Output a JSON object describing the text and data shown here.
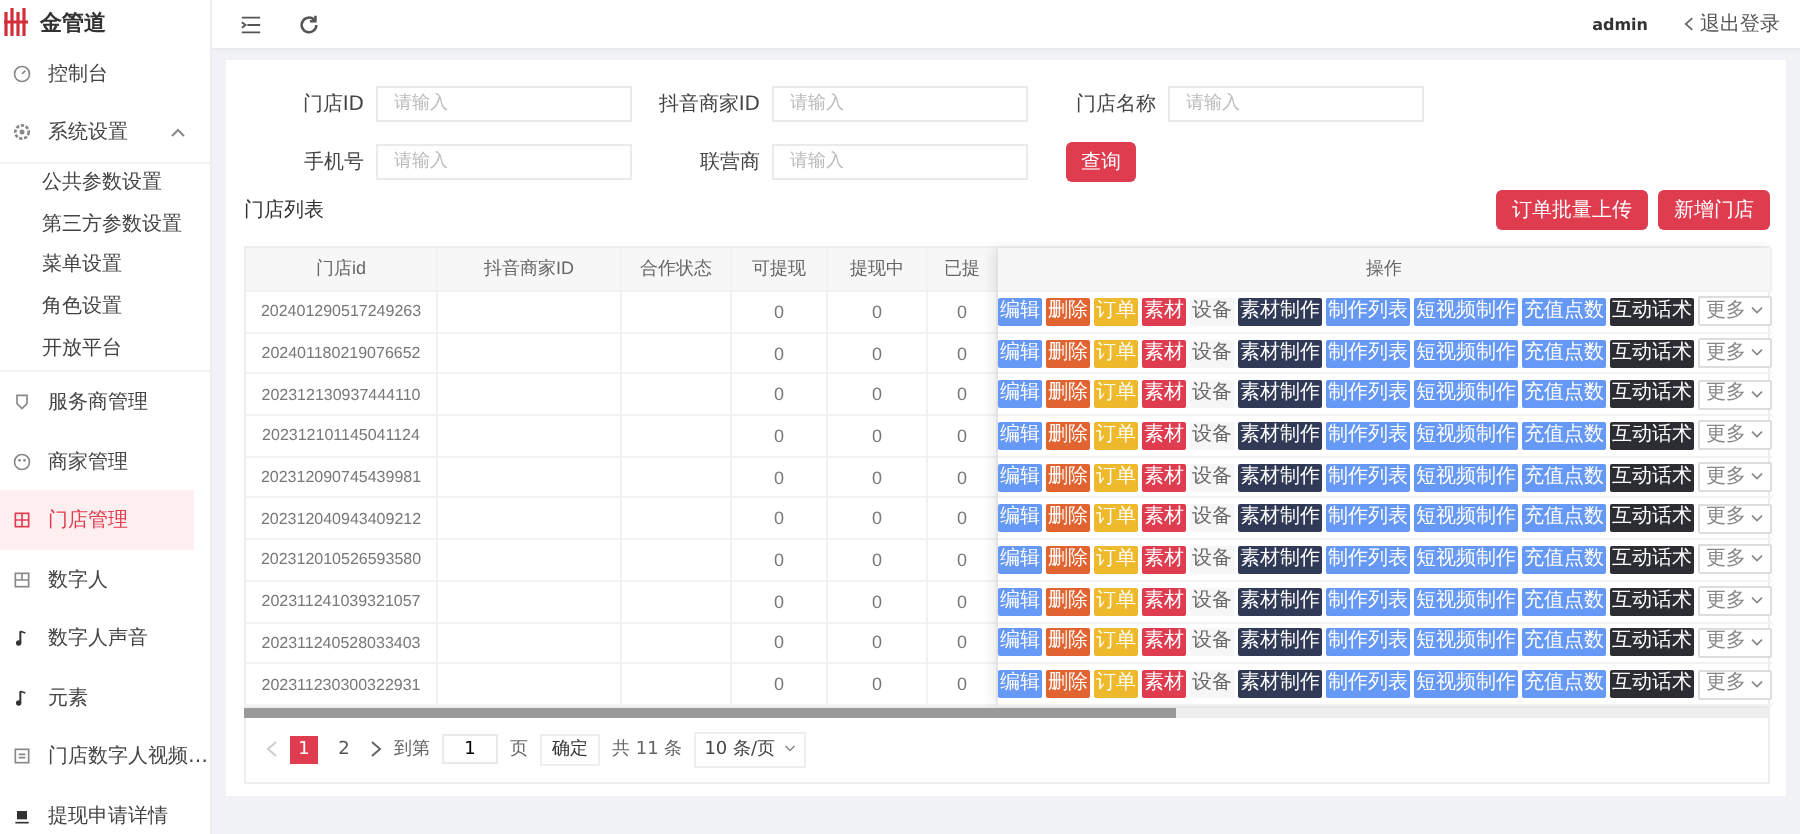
{
  "brand": {
    "name": "金管道"
  },
  "sidebar": {
    "items": [
      {
        "label": "控制台",
        "selected": false
      },
      {
        "label": "系统设置",
        "selected": false,
        "expanded": true,
        "children": [
          {
            "label": "公共参数设置",
            "selected": false
          },
          {
            "label": "第三方参数设置",
            "selected": false
          },
          {
            "label": "菜单设置",
            "selected": false
          },
          {
            "label": "角色设置",
            "selected": false
          },
          {
            "label": "开放平台",
            "selected": false
          }
        ]
      },
      {
        "label": "服务商管理",
        "selected": false
      },
      {
        "label": "商家管理",
        "selected": false
      },
      {
        "label": "门店管理",
        "selected": true
      },
      {
        "label": "数字人",
        "selected": false
      },
      {
        "label": "数字人声音",
        "selected": false
      },
      {
        "label": "元素",
        "selected": false
      },
      {
        "label": "门店数字人视频…",
        "selected": false
      },
      {
        "label": "提现申请详情",
        "selected": false
      }
    ]
  },
  "header": {
    "user": "admin",
    "logout": "退出登录"
  },
  "filters": [
    {
      "label": "门店ID",
      "placeholder": "请输入"
    },
    {
      "label": "抖音商家ID",
      "placeholder": "请输入"
    },
    {
      "label": "门店名称",
      "placeholder": "请输入"
    },
    {
      "label": "手机号",
      "placeholder": "请输入"
    },
    {
      "label": "联营商",
      "placeholder": "请输入"
    }
  ],
  "search_button": "查询",
  "list_title": "门店列表",
  "toolbar_buttons": [
    "订单批量上传",
    "新增门店"
  ],
  "table": {
    "columns": [
      "门店id",
      "抖音商家ID",
      "合作状态",
      "可提现",
      "提现中",
      "已提"
    ],
    "actions_column": "操作",
    "rows": [
      {
        "store_id": "202401290517249263",
        "withdrawable": "0",
        "withdrawing": "0",
        "withdrawn": "0"
      },
      {
        "store_id": "202401180219076652",
        "withdrawable": "0",
        "withdrawing": "0",
        "withdrawn": "0"
      },
      {
        "store_id": "202312130937444110",
        "withdrawable": "0",
        "withdrawing": "0",
        "withdrawn": "0"
      },
      {
        "store_id": "202312101145041124",
        "withdrawable": "0",
        "withdrawing": "0",
        "withdrawn": "0"
      },
      {
        "store_id": "202312090745439981",
        "withdrawable": "0",
        "withdrawing": "0",
        "withdrawn": "0"
      },
      {
        "store_id": "202312040943409212",
        "withdrawable": "0",
        "withdrawing": "0",
        "withdrawn": "0"
      },
      {
        "store_id": "202312010526593580",
        "withdrawable": "0",
        "withdrawing": "0",
        "withdrawn": "0"
      },
      {
        "store_id": "202311241039321057",
        "withdrawable": "0",
        "withdrawing": "0",
        "withdrawn": "0"
      },
      {
        "store_id": "202311240528033403",
        "withdrawable": "0",
        "withdrawing": "0",
        "withdrawn": "0"
      },
      {
        "store_id": "202311230300322931",
        "withdrawable": "0",
        "withdrawing": "0",
        "withdrawn": "0"
      }
    ],
    "row_actions": [
      [
        {
          "label": "编辑",
          "kind": "primary"
        },
        {
          "label": "删除",
          "kind": "warning"
        },
        {
          "label": "订单",
          "kind": "caution"
        },
        {
          "label": "素材",
          "kind": "danger"
        },
        {
          "label": "设备",
          "kind": "plain"
        },
        {
          "label": "素材制作",
          "kind": "navy"
        },
        {
          "label": "制作列表",
          "kind": "primary"
        },
        {
          "label": "短视频制作",
          "kind": "primary"
        },
        {
          "label": "充值点数",
          "kind": "primary"
        },
        {
          "label": "互动话术",
          "kind": "dark"
        },
        {
          "label": "更多",
          "kind": "dropdown"
        }
      ],
      [
        {
          "label": "编辑",
          "kind": "primary"
        },
        {
          "label": "删除",
          "kind": "warning"
        },
        {
          "label": "订单",
          "kind": "caution"
        },
        {
          "label": "素材",
          "kind": "danger"
        },
        {
          "label": "设备",
          "kind": "plain"
        },
        {
          "label": "素材制作",
          "kind": "navy"
        },
        {
          "label": "制作列表",
          "kind": "primary"
        },
        {
          "label": "短视频制作",
          "kind": "primary"
        },
        {
          "label": "充值点数",
          "kind": "primary"
        },
        {
          "label": "互动话术",
          "kind": "dark"
        },
        {
          "label": "更多",
          "kind": "dropdown"
        }
      ],
      [
        {
          "label": "编辑",
          "kind": "primary"
        },
        {
          "label": "删除",
          "kind": "warning"
        },
        {
          "label": "订单",
          "kind": "caution"
        },
        {
          "label": "素材",
          "kind": "danger"
        },
        {
          "label": "设备",
          "kind": "plain"
        },
        {
          "label": "素材制作",
          "kind": "navy"
        },
        {
          "label": "制作列表",
          "kind": "primary"
        },
        {
          "label": "短视频制作",
          "kind": "primary"
        },
        {
          "label": "充值点数",
          "kind": "primary"
        },
        {
          "label": "互动话术",
          "kind": "dark"
        },
        {
          "label": "更多",
          "kind": "dropdown"
        }
      ],
      [
        {
          "label": "编辑",
          "kind": "primary"
        },
        {
          "label": "删除",
          "kind": "warning"
        },
        {
          "label": "订单",
          "kind": "caution"
        },
        {
          "label": "素材",
          "kind": "danger"
        },
        {
          "label": "设备",
          "kind": "plain"
        },
        {
          "label": "素材制作",
          "kind": "navy"
        },
        {
          "label": "制作列表",
          "kind": "primary"
        },
        {
          "label": "短视频制作",
          "kind": "primary"
        },
        {
          "label": "充值点数",
          "kind": "primary"
        },
        {
          "label": "互动话术",
          "kind": "dark"
        },
        {
          "label": "更多",
          "kind": "dropdown"
        }
      ],
      [
        {
          "label": "编辑",
          "kind": "primary"
        },
        {
          "label": "删除",
          "kind": "warning"
        },
        {
          "label": "订单",
          "kind": "caution"
        },
        {
          "label": "素材",
          "kind": "danger"
        },
        {
          "label": "设备",
          "kind": "plain"
        },
        {
          "label": "素材制作",
          "kind": "navy"
        },
        {
          "label": "制作列表",
          "kind": "primary"
        },
        {
          "label": "短视频制作",
          "kind": "primary"
        },
        {
          "label": "充值点数",
          "kind": "primary"
        },
        {
          "label": "互动话术",
          "kind": "dark"
        },
        {
          "label": "更多",
          "kind": "dropdown"
        }
      ],
      [
        {
          "label": "编辑",
          "kind": "primary"
        },
        {
          "label": "删除",
          "kind": "warning"
        },
        {
          "label": "订单",
          "kind": "caution"
        },
        {
          "label": "素材",
          "kind": "danger"
        },
        {
          "label": "设备",
          "kind": "plain"
        },
        {
          "label": "素材制作",
          "kind": "navy"
        },
        {
          "label": "制作列表",
          "kind": "primary"
        },
        {
          "label": "短视频制作",
          "kind": "primary"
        },
        {
          "label": "充值点数",
          "kind": "primary"
        },
        {
          "label": "互动话术",
          "kind": "dark"
        },
        {
          "label": "更多",
          "kind": "dropdown"
        }
      ],
      [
        {
          "label": "编辑",
          "kind": "primary"
        },
        {
          "label": "删除",
          "kind": "warning"
        },
        {
          "label": "订单",
          "kind": "caution"
        },
        {
          "label": "素材",
          "kind": "danger"
        },
        {
          "label": "设备",
          "kind": "plain"
        },
        {
          "label": "素材制作",
          "kind": "navy"
        },
        {
          "label": "制作列表",
          "kind": "primary"
        },
        {
          "label": "短视频制作",
          "kind": "primary"
        },
        {
          "label": "充值点数",
          "kind": "primary"
        },
        {
          "label": "互动话术",
          "kind": "dark"
        },
        {
          "label": "更多",
          "kind": "dropdown"
        }
      ],
      [
        {
          "label": "编辑",
          "kind": "primary"
        },
        {
          "label": "删除",
          "kind": "warning"
        },
        {
          "label": "订单",
          "kind": "caution"
        },
        {
          "label": "素材",
          "kind": "danger"
        },
        {
          "label": "设备",
          "kind": "plain"
        },
        {
          "label": "素材制作",
          "kind": "navy"
        },
        {
          "label": "制作列表",
          "kind": "primary"
        },
        {
          "label": "短视频制作",
          "kind": "primary"
        },
        {
          "label": "充值点数",
          "kind": "primary"
        },
        {
          "label": "互动话术",
          "kind": "dark"
        },
        {
          "label": "更多",
          "kind": "dropdown"
        }
      ],
      [
        {
          "label": "编辑",
          "kind": "primary"
        },
        {
          "label": "删除",
          "kind": "warning"
        },
        {
          "label": "订单",
          "kind": "caution"
        },
        {
          "label": "素材",
          "kind": "danger"
        },
        {
          "label": "设备",
          "kind": "plain"
        },
        {
          "label": "素材制作",
          "kind": "navy"
        },
        {
          "label": "制作列表",
          "kind": "primary"
        },
        {
          "label": "短视频制作",
          "kind": "primary"
        },
        {
          "label": "充值点数",
          "kind": "primary"
        },
        {
          "label": "互动话术",
          "kind": "dark"
        },
        {
          "label": "更多",
          "kind": "dropdown"
        }
      ],
      [
        {
          "label": "编辑",
          "kind": "primary"
        },
        {
          "label": "删除",
          "kind": "warning"
        },
        {
          "label": "订单",
          "kind": "caution"
        },
        {
          "label": "素材",
          "kind": "danger"
        },
        {
          "label": "设备",
          "kind": "plain"
        },
        {
          "label": "素材制作",
          "kind": "navy"
        },
        {
          "label": "制作列表",
          "kind": "primary"
        },
        {
          "label": "短视频制作",
          "kind": "primary"
        },
        {
          "label": "充值点数",
          "kind": "primary"
        },
        {
          "label": "互动话术",
          "kind": "dark"
        },
        {
          "label": "更多",
          "kind": "dropdown"
        }
      ]
    ]
  },
  "pagination": {
    "pages": [
      {
        "label": "1",
        "selected": true
      },
      {
        "label": "2",
        "selected": false
      }
    ],
    "goto_label": "到第",
    "goto_value": "1",
    "page_unit": "页",
    "confirm": "确定",
    "total": "共 11 条",
    "page_size": "10 条/页"
  }
}
